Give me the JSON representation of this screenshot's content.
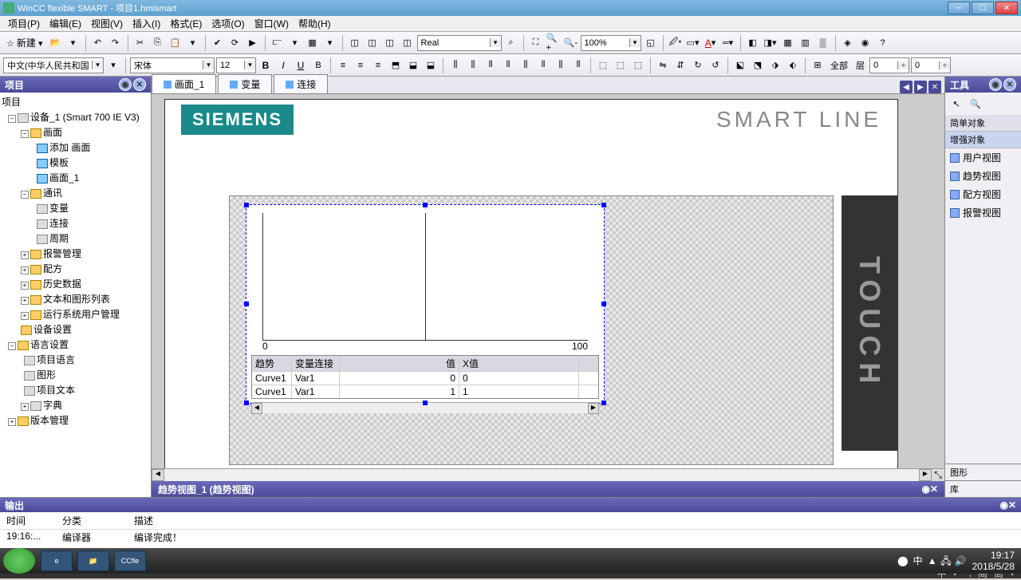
{
  "window": {
    "title": "WinCC flexible SMART - 项目1.hmismart"
  },
  "menus": [
    "项目(P)",
    "编辑(E)",
    "视图(V)",
    "插入(I)",
    "格式(E)",
    "选项(O)",
    "窗口(W)",
    "帮助(H)"
  ],
  "toolbar1": {
    "new_label": "新建",
    "format_field": "Real",
    "zoom": "100%"
  },
  "toolbar2": {
    "lang": "中文(中华人民共和国)",
    "font": "宋体",
    "size": "12",
    "all_label": "全部",
    "layer_label": "层",
    "layer_a": "0",
    "layer_b": "0"
  },
  "projectPanel": {
    "title": "项目",
    "root": "项目",
    "device": "设备_1 (Smart 700 IE V3)",
    "nodes": {
      "screens": "画面",
      "addScreen": "添加 画面",
      "template": "模板",
      "screen1": "画面_1",
      "comm": "通讯",
      "variables": "变量",
      "connections": "连接",
      "cycles": "周期",
      "alarmMgmt": "报警管理",
      "recipes": "配方",
      "history": "历史数据",
      "textGraphics": "文本和图形列表",
      "runtimeUsers": "运行系统用户管理",
      "deviceSettings": "设备设置",
      "langSettings": "语言设置",
      "projLang": "项目语言",
      "graphics": "图形",
      "projText": "项目文本",
      "dict": "字典",
      "versionMgmt": "版本管理"
    }
  },
  "tabs": [
    {
      "label": "画面_1",
      "active": true
    },
    {
      "label": "变量",
      "active": false
    },
    {
      "label": "连接",
      "active": false
    }
  ],
  "hmi": {
    "logo": "SIEMENS",
    "brand": "SMART LINE",
    "touch": "TOUCH",
    "axis0": "0",
    "axis100": "100"
  },
  "trendTable": {
    "headers": [
      "趋势",
      "变量连接",
      "值",
      "X值"
    ],
    "rows": [
      {
        "name": "Curve1",
        "var": "Var1",
        "val": "0",
        "xval": "0"
      },
      {
        "name": "Curve1",
        "var": "Var1",
        "val": "1",
        "xval": "1"
      }
    ]
  },
  "toolsPanel": {
    "title": "工具",
    "sections": {
      "simple": "简单对象",
      "enhanced": "增强对象"
    },
    "items": [
      "用户视图",
      "趋势视图",
      "配方视图",
      "报警视图"
    ],
    "bottomLabels": [
      "图形",
      "库"
    ]
  },
  "propBar": {
    "title": "趋势视图_1 (趋势视图)"
  },
  "output": {
    "title": "输出",
    "cols": [
      "时间",
      "分类",
      "描述"
    ],
    "row": {
      "time": "19:16:...",
      "cat": "编译器",
      "desc": "编译完成！"
    },
    "tab": "输出"
  },
  "status": {
    "items": [
      "中",
      "◐",
      "°,",
      "简",
      "筒"
    ]
  },
  "taskbar": {
    "apps": [
      "e",
      "📁",
      "CCfle"
    ],
    "time": "19:17",
    "date": "2018/5/28",
    "ime": "中"
  }
}
